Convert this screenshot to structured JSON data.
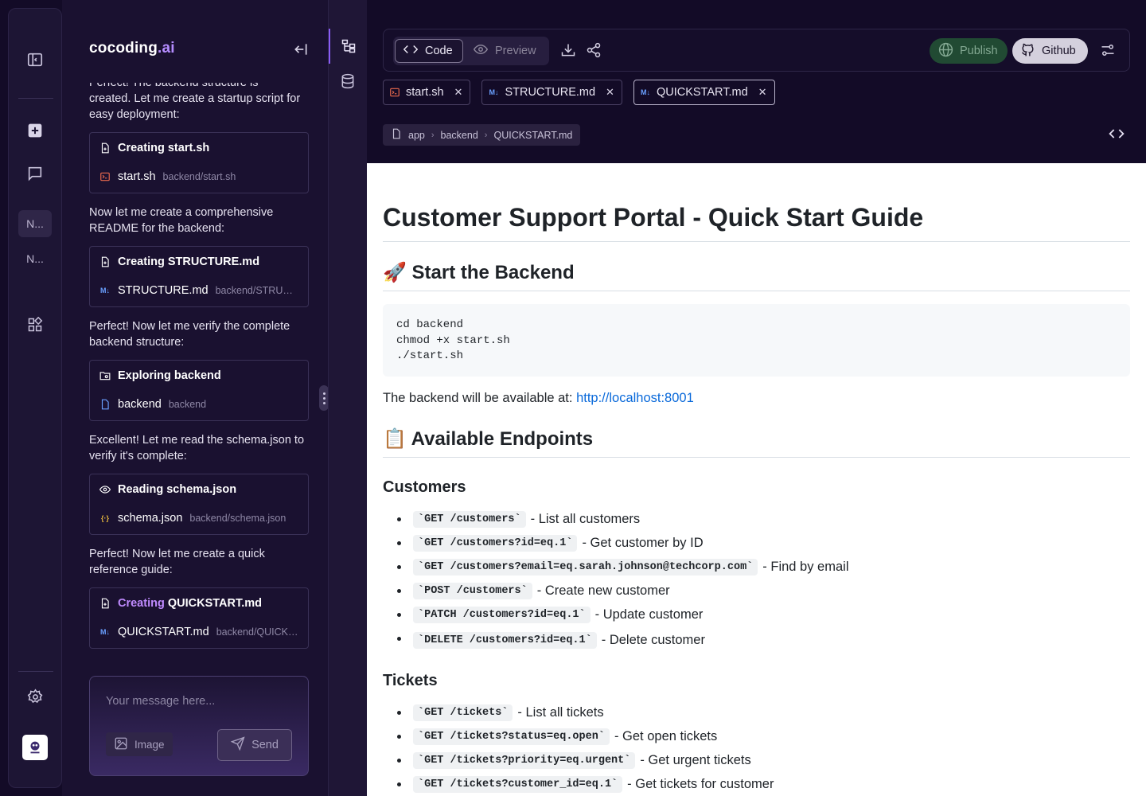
{
  "rail": {
    "chips": [
      "N...",
      "N..."
    ]
  },
  "brand": {
    "name": "cocoding",
    "suffix": ".ai"
  },
  "chat": {
    "partial_top": "Perfect! The backend structure is",
    "messages": [
      {
        "text": "created. Let me create a startup script for easy deployment:",
        "card": {
          "verb": "Creating",
          "target": "start.sh",
          "file": "start.sh",
          "path": "backend/start.sh",
          "file_icon": "shell-icon"
        }
      },
      {
        "text": "Now let me create a comprehensive README for the backend:",
        "card": {
          "verb": "Creating",
          "target": "STRUCTURE.md",
          "file": "STRUCTURE.md",
          "path": "backend/STRUCTURE.md",
          "file_icon": "markdown-icon"
        }
      },
      {
        "text": "Perfect! Now let me verify the complete backend structure:",
        "card": {
          "verb": "Exploring",
          "target": "backend",
          "file": "backend",
          "path": "backend",
          "file_icon": "folder-icon"
        }
      },
      {
        "text": "Excellent! Let me read the schema.json to verify it's complete:",
        "card": {
          "verb": "Reading",
          "target": "schema.json",
          "file": "schema.json",
          "path": "backend/schema.json",
          "file_icon": "json-icon"
        }
      },
      {
        "text": "Perfect! Now let me create a quick reference guide:",
        "card": {
          "verb": "Creating",
          "target": "QUICKSTART.md",
          "file": "QUICKSTART.md",
          "path": "backend/QUICKSTART.md",
          "file_icon": "markdown-icon"
        }
      }
    ],
    "composer": {
      "placeholder": "Your message here...",
      "image_label": "Image",
      "send_label": "Send"
    }
  },
  "toolbar": {
    "code_label": "Code",
    "preview_label": "Preview",
    "publish_label": "Publish",
    "github_label": "Github"
  },
  "tabs": [
    {
      "label": "start.sh",
      "icon": "shell-icon",
      "active": false
    },
    {
      "label": "STRUCTURE.md",
      "icon": "markdown-icon",
      "active": false
    },
    {
      "label": "QUICKSTART.md",
      "icon": "markdown-icon",
      "active": true
    }
  ],
  "breadcrumb": [
    "app",
    "backend",
    "QUICKSTART.md"
  ],
  "doc": {
    "title": "Customer Support Portal - Quick Start Guide",
    "start_heading": "🚀 Start the Backend",
    "code_lines": [
      "cd backend",
      "chmod +x start.sh",
      "./start.sh"
    ],
    "available_text": "The backend will be available at:",
    "available_link": "http://localhost:8001",
    "endpoints_heading": "📋 Available Endpoints",
    "customers_heading": "Customers",
    "customers": [
      {
        "code": "`GET /customers`",
        "desc": "- List all customers"
      },
      {
        "code": "`GET /customers?id=eq.1`",
        "desc": "- Get customer by ID"
      },
      {
        "code": "`GET /customers?email=eq.sarah.johnson@techcorp.com`",
        "desc": "- Find by email"
      },
      {
        "code": "`POST /customers`",
        "desc": "- Create new customer"
      },
      {
        "code": "`PATCH /customers?id=eq.1`",
        "desc": "- Update customer"
      },
      {
        "code": "`DELETE /customers?id=eq.1`",
        "desc": "- Delete customer"
      }
    ],
    "tickets_heading": "Tickets",
    "tickets": [
      {
        "code": "`GET /tickets`",
        "desc": "- List all tickets"
      },
      {
        "code": "`GET /tickets?status=eq.open`",
        "desc": "- Get open tickets"
      },
      {
        "code": "`GET /tickets?priority=eq.urgent`",
        "desc": "- Get urgent tickets"
      },
      {
        "code": "`GET /tickets?customer_id=eq.1`",
        "desc": "- Get tickets for customer"
      }
    ]
  },
  "colors": {
    "accent": "#8a5cf6",
    "link": "#0969da",
    "publish_bg": "#214a33"
  }
}
